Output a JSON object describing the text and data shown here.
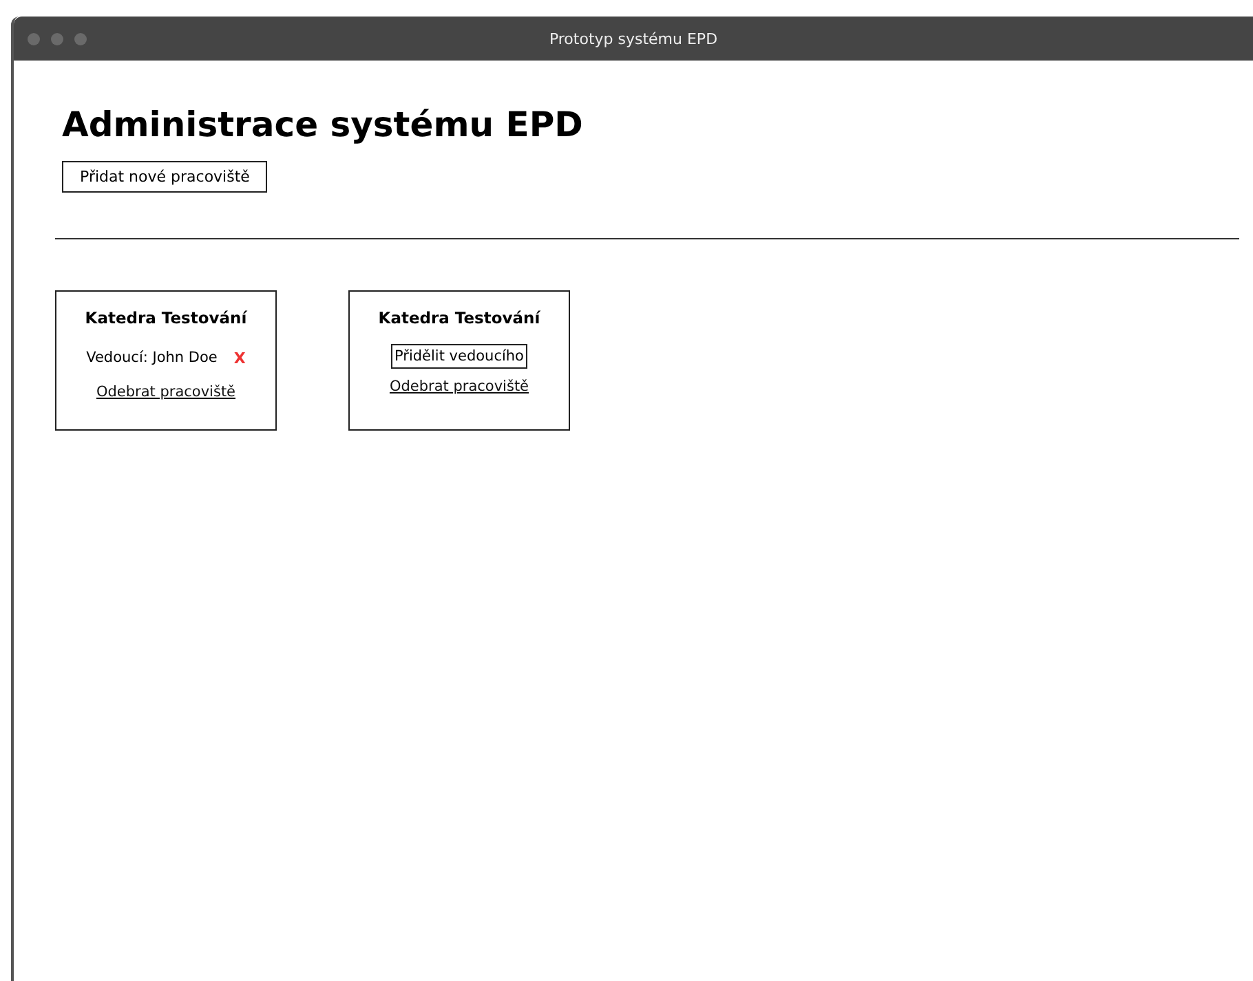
{
  "window": {
    "title": "Prototyp systému EPD"
  },
  "heading": "Administrace systému EPD",
  "add_button": "Přidat nové pracoviště",
  "workplaces": [
    {
      "name": "Katedra Testování",
      "kind": "leader",
      "leader": "Vedoucí: John Doe",
      "remove_leader": "X",
      "remove": "Odebrat pracoviště"
    },
    {
      "name": "Katedra Testování",
      "kind": "assign",
      "assign": "Přidělit vedoucího",
      "remove": "Odebrat pracoviště"
    }
  ]
}
